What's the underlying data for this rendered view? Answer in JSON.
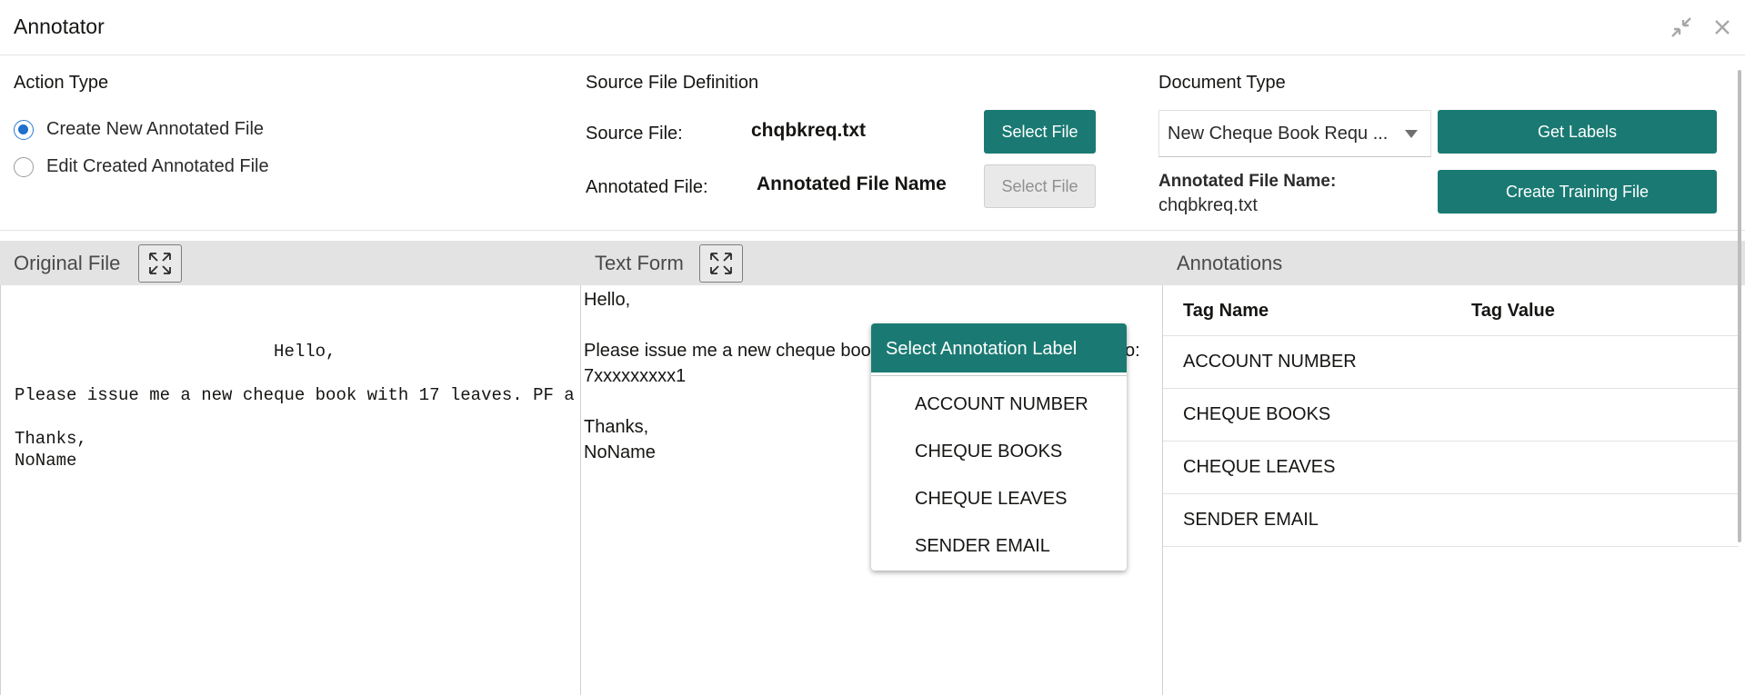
{
  "window": {
    "title": "Annotator",
    "icons": [
      "collapse-icon",
      "close-icon"
    ]
  },
  "action_type": {
    "title": "Action Type",
    "options": [
      {
        "label": "Create New Annotated File",
        "selected": true
      },
      {
        "label": "Edit Created Annotated File",
        "selected": false
      }
    ]
  },
  "source_def": {
    "title": "Source File Definition",
    "source_label": "Source File:",
    "source_value": "chqbkreq.txt",
    "source_button": "Select File",
    "annotated_label": "Annotated File:",
    "annotated_value": "Annotated File Name",
    "annotated_button": "Select File"
  },
  "doc_type": {
    "title": "Document Type",
    "selected": "New Cheque Book Requ ...",
    "get_labels_button": "Get Labels",
    "create_training_button": "Create Training File",
    "annotated_name_label": "Annotated File Name:",
    "annotated_name_value": "chqbkreq.txt"
  },
  "panels": {
    "original_title": "Original File",
    "text_title": "Text Form",
    "annotations_title": "Annotations"
  },
  "original_file": {
    "lines": [
      "                         Hello,",
      "Please issue me a new cheque book with 17 leaves. PF a",
      "",
      "Thanks,",
      "NoName"
    ]
  },
  "text_form": {
    "lines": [
      "Hello,",
      "Please issue me a new cheque boo",
      "o:",
      "7xxxxxxxxx1",
      "Thanks,",
      "NoName"
    ]
  },
  "annotations": {
    "headers": {
      "name": "Tag Name",
      "value": "Tag Value"
    },
    "rows": [
      {
        "name": "ACCOUNT NUMBER",
        "value": ""
      },
      {
        "name": "CHEQUE BOOKS",
        "value": ""
      },
      {
        "name": "CHEQUE LEAVES",
        "value": ""
      },
      {
        "name": "SENDER EMAIL",
        "value": ""
      }
    ]
  },
  "popup": {
    "title": "Select Annotation Label",
    "items": [
      "ACCOUNT NUMBER",
      "CHEQUE BOOKS",
      "CHEQUE LEAVES",
      "SENDER EMAIL"
    ]
  },
  "colors": {
    "accent": "#1a7a73",
    "radio_selected": "#1f6fcc",
    "band": "#e3e3e3"
  }
}
